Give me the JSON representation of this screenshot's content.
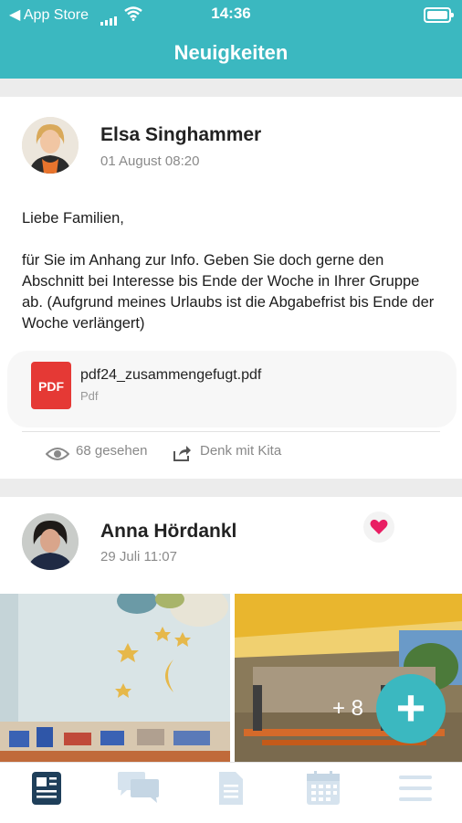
{
  "status_bar": {
    "carrier": "◀ App Store",
    "time": "14:36"
  },
  "header": {
    "title": "Neuigkeiten"
  },
  "posts": [
    {
      "author": "Elsa Singhammer",
      "date": "01 August 08:20",
      "greeting": "Liebe Familien,",
      "body": "für Sie im Anhang zur Info. Geben Sie doch gerne den Abschnitt bei Interesse bis Ende der Woche in Ihrer Gruppe ab. (Aufgrund meines Urlaubs ist die Abgabefrist bis Ende der Woche verlängert)",
      "attachment": {
        "name": "pdf24_zusammengefugt.pdf",
        "type": "Pdf",
        "icon_label": "PDF"
      },
      "views": "68 gesehen",
      "shared_with": "Denk mit Kita"
    },
    {
      "author": "Anna Hördankl",
      "date": "29 Juli 11:07",
      "more_photos": "+ 8"
    }
  ],
  "fab": {
    "symbol": "+"
  },
  "tabs": [
    "news-icon",
    "chat-icon",
    "document-icon",
    "calendar-icon",
    "menu-icon"
  ],
  "colors": {
    "accent": "#3bb8c0",
    "pdf": "#e53935",
    "heart": "#e91e63"
  }
}
